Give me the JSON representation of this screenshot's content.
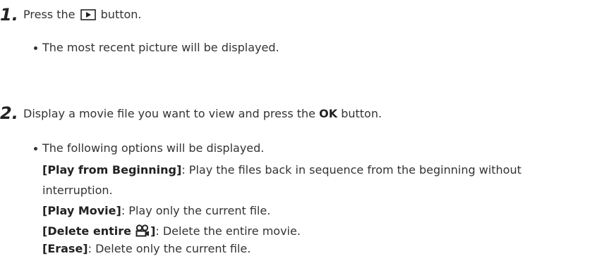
{
  "step1": {
    "number": "1.",
    "text_before": "Press the",
    "icon": "playback-button-icon",
    "text_after": "button.",
    "bullet": "The most recent picture will be displayed."
  },
  "step2": {
    "number": "2.",
    "text_before": "Display a movie file you want to view and press the",
    "bold_word": "OK",
    "text_after": "button.",
    "intro": "The following options will be displayed.",
    "options": [
      {
        "label": "[Play from Beginning]",
        "desc_line1": ": Play the files back in sequence from the beginning without",
        "desc_line2": "interruption."
      },
      {
        "label": "[Play Movie]",
        "desc": ": Play only the current file."
      },
      {
        "label_prefix": "[Delete entire",
        "label_icon": "movie-camera-icon",
        "label_suffix": "]",
        "desc": ": Delete the entire movie."
      },
      {
        "label": "[Erase]",
        "desc": ": Delete only the current file."
      }
    ]
  }
}
